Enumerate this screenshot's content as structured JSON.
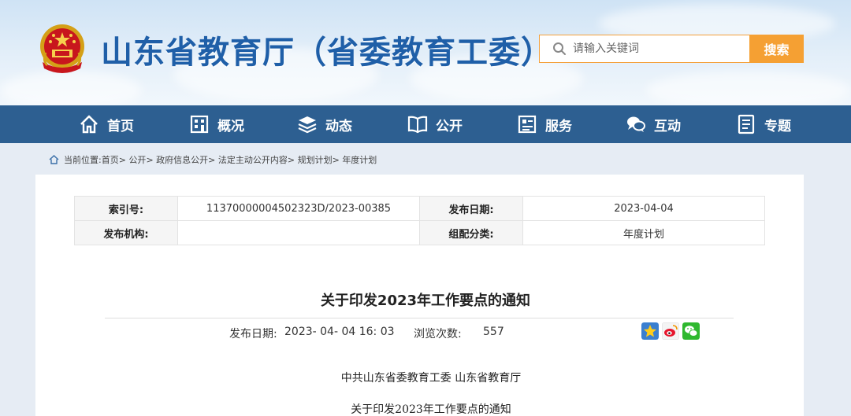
{
  "header": {
    "site_title": "山东省教育厅（省委教育工委）",
    "search_placeholder": "请输入关键词",
    "search_button": "搜索"
  },
  "nav": {
    "items": [
      {
        "label": "首页",
        "icon": "home-icon"
      },
      {
        "label": "概况",
        "icon": "building-icon"
      },
      {
        "label": "动态",
        "icon": "layers-icon"
      },
      {
        "label": "公开",
        "icon": "book-icon"
      },
      {
        "label": "服务",
        "icon": "service-icon"
      },
      {
        "label": "互动",
        "icon": "chat-icon"
      },
      {
        "label": "专题",
        "icon": "document-icon"
      }
    ]
  },
  "breadcrumb": {
    "prefix": "当前位置: ",
    "path": [
      "首页",
      "公开",
      "政府信息公开",
      "法定主动公开内容",
      "规划计划",
      "年度计划"
    ],
    "separator": ">"
  },
  "meta": {
    "index_label": "索引号:",
    "index_value": "11370000004502323D/2023-00385",
    "date_label": "发布日期:",
    "date_value": "2023-04-04",
    "org_label": "发布机构:",
    "org_value": "",
    "category_label": "组配分类:",
    "category_value": "年度计划"
  },
  "article": {
    "title": "关于印发2023年工作要点的通知",
    "publish_label": "发布日期:",
    "publish_value": "2023- 04- 04 16: 03",
    "views_label": "浏览次数:",
    "views_value": "557",
    "issuer_line": "中共山东省委教育工委  山东省教育厅",
    "body_title": "关于印发2023年工作要点的通知"
  },
  "share": {
    "icons": [
      "favorite-star-icon",
      "weibo-icon",
      "wechat-icon"
    ]
  },
  "colors": {
    "brand_blue": "#1f5fa8",
    "nav_bg": "#2d5f91",
    "search_orange": "#f5a033"
  }
}
